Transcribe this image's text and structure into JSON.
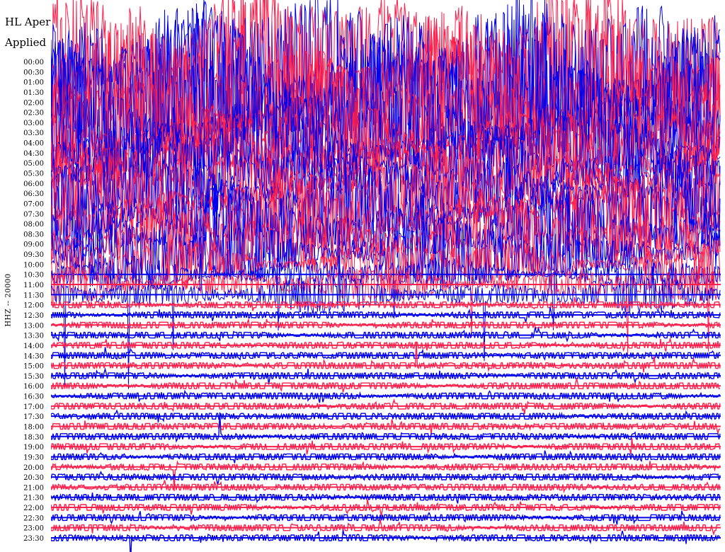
{
  "header": {
    "title_line_1": "HL Aper",
    "title_line_2": "Applied"
  },
  "chart_data": {
    "type": "line",
    "subtype": "helicorder",
    "ylabel": "HHZ -- 20000",
    "row_times": [
      "00:00",
      "00:30",
      "01:00",
      "01:30",
      "02:00",
      "02:30",
      "03:00",
      "03:30",
      "04:00",
      "04:30",
      "05:00",
      "05:30",
      "06:00",
      "06:30",
      "07:00",
      "07:30",
      "08:00",
      "08:30",
      "09:00",
      "09:30",
      "10:00",
      "10:30",
      "11:00",
      "11:30",
      "12:00",
      "12:30",
      "13:00",
      "13:30",
      "14:00",
      "14:30",
      "15:00",
      "15:30",
      "16:00",
      "16:30",
      "17:00",
      "17:30",
      "18:00",
      "18:30",
      "19:00",
      "19:30",
      "20:00",
      "20:30",
      "21:00",
      "21:30",
      "22:00",
      "22:30",
      "23:00",
      "23:30"
    ],
    "trace_colors": [
      "#ff1f4b",
      "#0000ee"
    ],
    "color_alternation": "alternating by row",
    "row_amplitude_level": [
      10,
      10,
      10,
      10,
      10,
      10,
      7,
      6,
      5,
      5,
      5,
      5,
      5,
      5,
      5,
      5,
      5,
      5,
      5,
      4,
      3,
      2,
      2,
      2,
      1,
      1,
      1,
      1,
      1,
      1,
      1,
      1,
      1,
      1,
      1,
      1,
      1,
      1,
      1,
      1,
      1,
      1,
      1,
      1,
      1,
      1,
      1,
      1
    ],
    "grid": false,
    "legend": "none"
  },
  "colors": {
    "background": "#ffffff",
    "trace_red": "#ff1f4b",
    "trace_blue": "#0000ee",
    "text": "#000000"
  }
}
